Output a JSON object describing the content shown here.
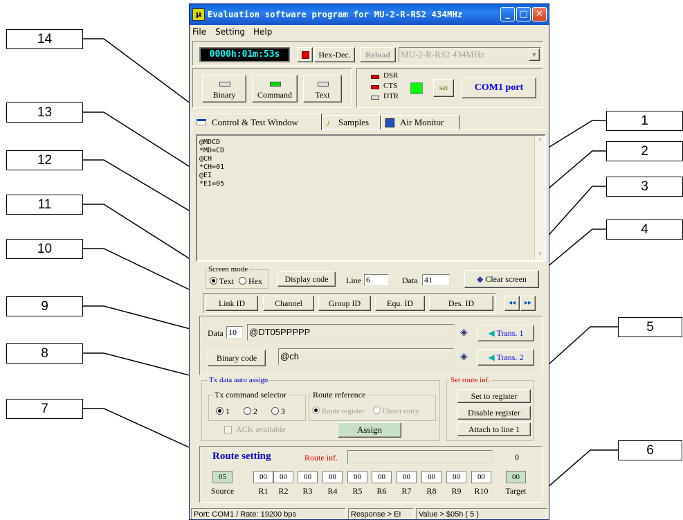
{
  "window": {
    "title": "Evaluation software program for MU-2-R-RS2  434MHz",
    "icon_glyph": "μ",
    "minimize": "_",
    "maximize": "□",
    "close": "✕"
  },
  "menu": [
    "File",
    "Setting",
    "Help"
  ],
  "toolbar": {
    "timer": "0000h:01m:53s",
    "hexdec_label": "Hex-Dec.",
    "reload_label": "Reload",
    "device_select": "MU-2-R-RS2  434MHz",
    "mode_buttons": [
      "Binary",
      "Command",
      "Text"
    ],
    "signals": [
      "DSR",
      "CTS",
      "DTR"
    ],
    "set_label": "set",
    "com_port_label": "COM1 port"
  },
  "tabs": [
    "Control  & Test Window",
    "Samples",
    "Air Monitor"
  ],
  "screen": {
    "lines": [
      "@MDCD",
      "*MD=CD",
      "@CH",
      "*CH=01",
      "@EI",
      "*EI=05"
    ]
  },
  "controls": {
    "screen_mode_label": "Screen mode",
    "screen_mode_options": [
      "Text",
      "Hex"
    ],
    "display_code_label": "Display code",
    "line_label": "Line",
    "line_value": "6",
    "data_label": "Data",
    "data_value": "41",
    "clear_screen_label": "Clear screen"
  },
  "id_buttons": [
    "Link ID",
    "Channel",
    "Group ID",
    "Equ. ID",
    "Des. ID"
  ],
  "nav": {
    "back": "◂◂",
    "fwd": "▸▸"
  },
  "tx": {
    "data_label": "Data",
    "data_count": "10",
    "data_input": "@DT05PPPPP",
    "trans1_label": "Trans. 1",
    "binary_code_label": "Binary code",
    "input2": "@ch",
    "trans2_label": "Trans. 2"
  },
  "auto_assign": {
    "title": "Tx data auto assign",
    "selector_title": "Tx command selector",
    "selector_options": [
      "1",
      "2",
      "3"
    ],
    "route_ref_title": "Route reference",
    "route_ref_options": [
      "Route register",
      "Direct entry"
    ],
    "ack_label": "ACK available",
    "assign_label": "Assign"
  },
  "set_route": {
    "title": "Set route inf.",
    "buttons": [
      "Set to register",
      "Disable register",
      "Attach to line 1"
    ]
  },
  "route": {
    "title": "Route setting",
    "route_inf_label": "Route inf.",
    "count": "0",
    "source_value": "05",
    "relay_values": [
      "00",
      "00",
      "00",
      "00",
      "00",
      "00",
      "00",
      "00",
      "00",
      "00"
    ],
    "target_value": "00",
    "labels": [
      "Source",
      "R1",
      "R2",
      "R3",
      "R4",
      "R5",
      "R6",
      "R7",
      "R8",
      "R9",
      "R10",
      "Target"
    ]
  },
  "status": {
    "port": "Port: COM1 / Rate: 19200 bps",
    "response": "Response > EI",
    "value": "Value > $05h ( 5 )"
  },
  "callouts": [
    "1",
    "2",
    "3",
    "4",
    "5",
    "6",
    "7",
    "8",
    "9",
    "10",
    "11",
    "12",
    "13",
    "14"
  ],
  "colors": {
    "title_bar": "#1a5fd8",
    "timer_bg": "#000000",
    "timer_fg": "#00ffff",
    "led_red": "#e00000",
    "led_green": "#00e000",
    "accent_blue": "#0000ff",
    "route_red": "#e00000",
    "assign_bg": "#c8e0c8"
  }
}
